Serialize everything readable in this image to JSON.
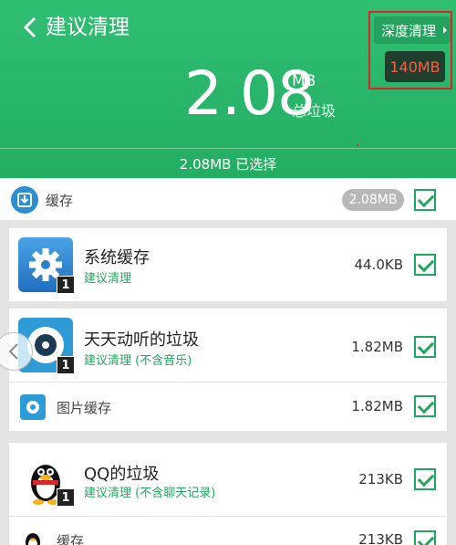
{
  "header": {
    "back_icon": "chevron-left-icon",
    "title": "建议清理",
    "deep_clean_label": "深度清理",
    "deep_clean_badge": "140MB",
    "total_value": "2.08",
    "total_unit": "MB",
    "total_caption": "总垃圾",
    "selected_text": "2.08MB 已选择"
  },
  "category": {
    "icon": "download-box-icon",
    "label": "缓存",
    "size": "2.08MB",
    "checked": true
  },
  "items": [
    {
      "name": "系统缓存",
      "hint": "建议清理",
      "size": "44.0KB",
      "badge": "1",
      "icon": "gear-icon",
      "checked": true
    },
    {
      "name": "天天动听的垃圾",
      "hint": "建议清理 (不含音乐)",
      "size": "1.82MB",
      "badge": "1",
      "icon": "music-player-icon",
      "checked": true,
      "sub": {
        "label": "图片缓存",
        "size": "1.82MB",
        "icon": "image-cache-icon",
        "checked": true
      }
    },
    {
      "name": "QQ的垃圾",
      "hint": "建议清理 (不含聊天记录)",
      "size": "213KB",
      "badge": "1",
      "icon": "penguin-icon",
      "checked": true,
      "sub": {
        "label": "缓存",
        "size": "213KB",
        "icon": "penguin-small-icon",
        "checked": true
      }
    }
  ],
  "side_nav_icon": "chevron-left-circle-icon",
  "colors": {
    "header_green": "#2fbf73",
    "accent_green": "#23a65e",
    "alert_red": "#d8242b",
    "badge_text": "#ff5a45"
  }
}
